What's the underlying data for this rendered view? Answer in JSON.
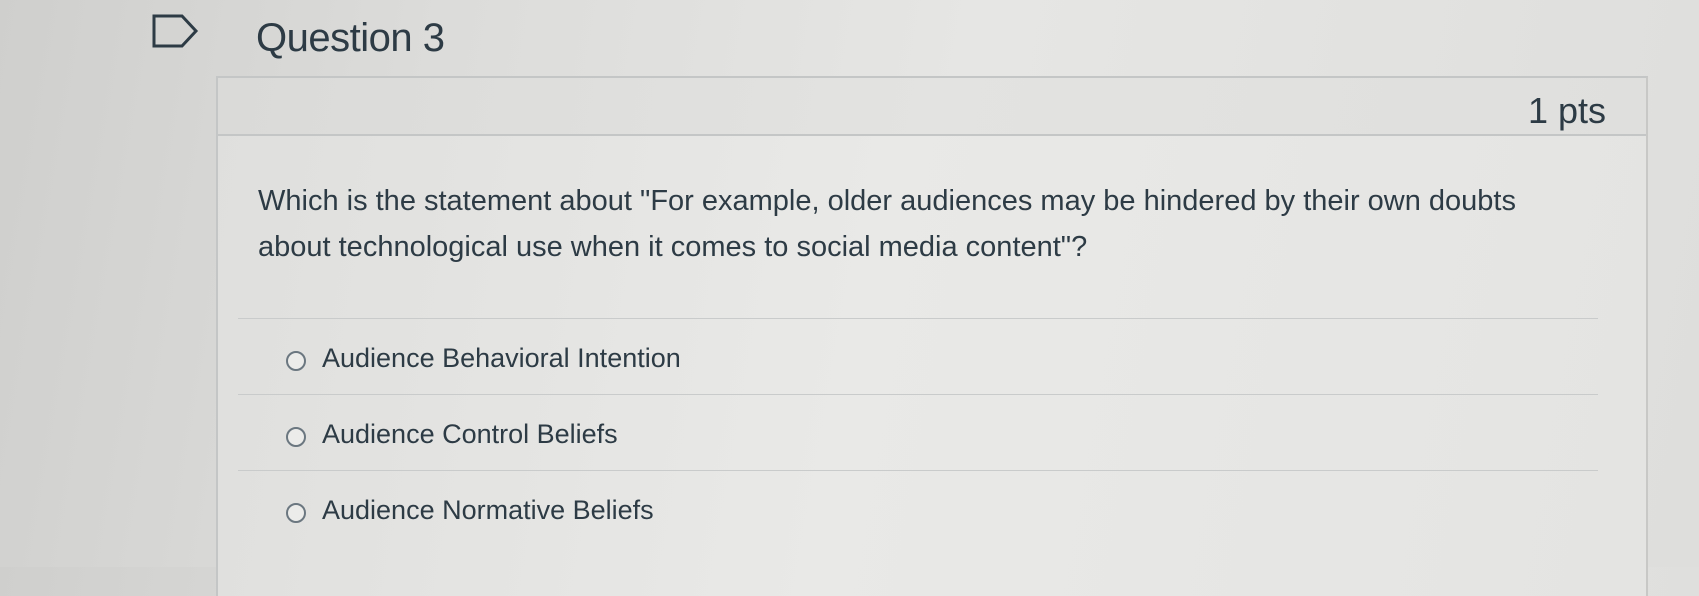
{
  "question": {
    "title": "Question 3",
    "points": "1 pts",
    "text": "Which is the statement about \"For example, older audiences may be hindered by their own doubts about technological use when it comes to social media content\"?"
  },
  "answers": [
    {
      "label": "Audience Behavioral Intention",
      "selected": false
    },
    {
      "label": "Audience Control Beliefs",
      "selected": false
    },
    {
      "label": "Audience Normative Beliefs",
      "selected": false
    }
  ],
  "icons": {
    "flag": "flag-question-icon",
    "radio": "radio-button-icon"
  }
}
